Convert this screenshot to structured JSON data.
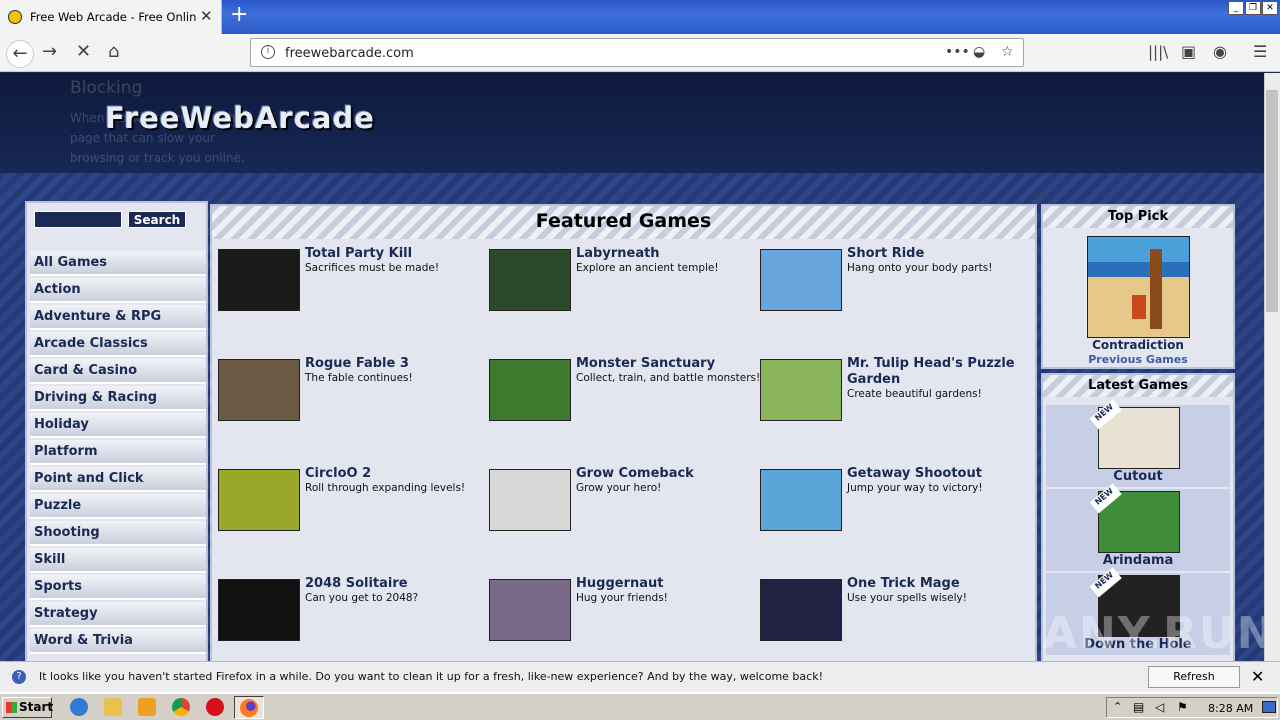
{
  "browser": {
    "tab_title": "Free Web Arcade - Free Online Ga",
    "new_tab": "+",
    "url": "freewebarcade.com",
    "page_actions": "•••",
    "window_controls": [
      "_",
      "❐",
      "✕"
    ]
  },
  "page": {
    "ghost_panel": {
      "title": "New in Firefox: Content Blocking",
      "body": "When blocking blocks on the page that can slow your browsing or track you online."
    },
    "logo": "FreeWebArcade",
    "search_button": "Search",
    "categories": [
      "All Games",
      "Action",
      "Adventure & RPG",
      "Arcade Classics",
      "Card & Casino",
      "Driving & Racing",
      "Holiday",
      "Platform",
      "Point and Click",
      "Puzzle",
      "Shooting",
      "Skill",
      "Sports",
      "Strategy",
      "Word & Trivia"
    ],
    "featured_title": "Featured Games",
    "games": [
      {
        "name": "Total Party Kill",
        "desc": "Sacrifices must be made!",
        "color": "#1a1a1a"
      },
      {
        "name": "Labyrneath",
        "desc": "Explore an ancient temple!",
        "color": "#2c4a2a"
      },
      {
        "name": "Short Ride",
        "desc": "Hang onto your body parts!",
        "color": "#6aa6de"
      },
      {
        "name": "Rogue Fable 3",
        "desc": "The fable continues!",
        "color": "#6b5a44"
      },
      {
        "name": "Monster Sanctuary",
        "desc": "Collect, train, and battle monsters!",
        "color": "#3d7a2e"
      },
      {
        "name": "Mr. Tulip Head's Puzzle Garden",
        "desc": "Create beautiful gardens!",
        "color": "#8ab55a"
      },
      {
        "name": "CircloO 2",
        "desc": "Roll through expanding levels!",
        "color": "#9aa82a"
      },
      {
        "name": "Grow Comeback",
        "desc": "Grow your hero!",
        "color": "#d8d8d8"
      },
      {
        "name": "Getaway Shootout",
        "desc": "Jump your way to victory!",
        "color": "#5aa6d8"
      },
      {
        "name": "2048 Solitaire",
        "desc": "Can you get to 2048?",
        "color": "#111111"
      },
      {
        "name": "Huggernaut",
        "desc": "Hug your friends!",
        "color": "#7a6a8a"
      },
      {
        "name": "One Trick Mage",
        "desc": "Use your spells wisely!",
        "color": "#222244"
      }
    ],
    "top_pick": {
      "title": "Top Pick",
      "name": "Contradiction",
      "link": "Previous Games",
      "color": "#3a87c8"
    },
    "latest": {
      "title": "Latest Games",
      "badge": "NEW",
      "items": [
        {
          "name": "Cutout",
          "color": "#e9e2d2"
        },
        {
          "name": "Arindama",
          "color": "#3f8c3a"
        },
        {
          "name": "Down the Hole",
          "color": "#222222"
        }
      ]
    }
  },
  "notification": {
    "text": "It looks like you haven't started Firefox in a while. Do you want to clean it up for a fresh, like-new experience? And by the way, welcome back!",
    "button": "Refresh Firefox…",
    "close": "✕"
  },
  "taskbar": {
    "start": "Start",
    "clock": "8:28 AM"
  },
  "watermark": "ANY.RUN"
}
